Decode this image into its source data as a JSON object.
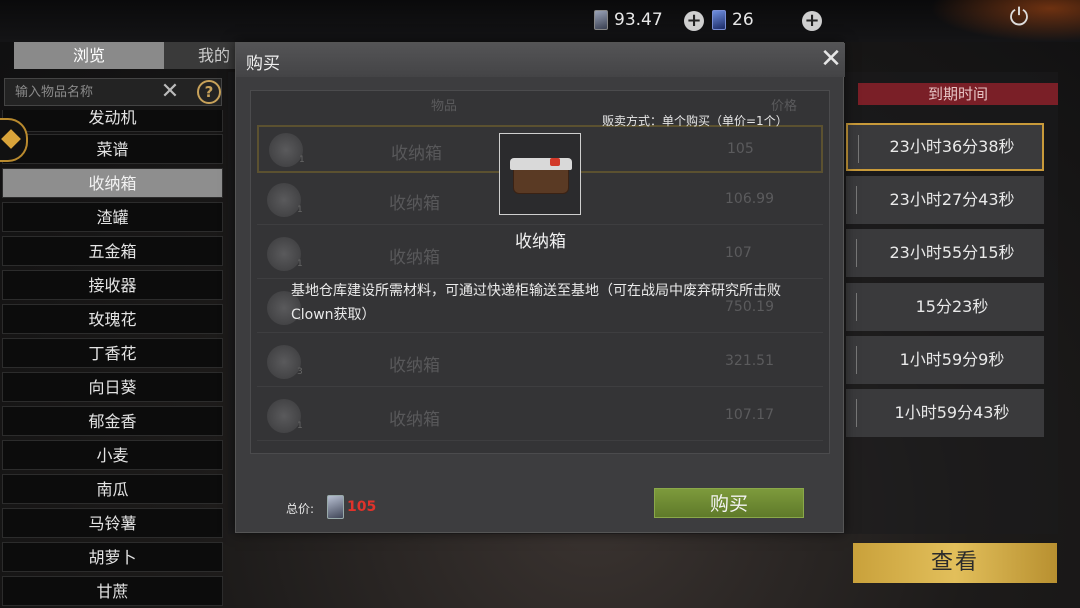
{
  "topbar": {
    "coin_value": "93.47",
    "gem_value": "26",
    "icons": [
      "coin-icon",
      "plus-icon",
      "gem-icon",
      "power-icon"
    ]
  },
  "tabs": {
    "browse": "浏览",
    "mine": "我的"
  },
  "search": {
    "placeholder": "输入物品名称"
  },
  "categories": [
    "发动机",
    "菜谱",
    "收纳箱",
    "渣罐",
    "五金箱",
    "接收器",
    "玫瑰花",
    "丁香花",
    "向日葵",
    "郁金香",
    "小麦",
    "南瓜",
    "马铃薯",
    "胡萝卜",
    "甘蔗"
  ],
  "selected_category": "收纳箱",
  "expiry": {
    "header": "到期时间",
    "rows": [
      "23小时36分38秒",
      "23小时27分43秒",
      "23小时55分15秒",
      "15分23秒",
      "1小时59分9秒",
      "1小时59分43秒"
    ]
  },
  "view_button": "查看",
  "modal": {
    "title": "购买",
    "sale_mode": "贩卖方式：单个购买（单价=1个）",
    "item_name": "收纳箱",
    "description": "基地仓库建设所需材料，可通过快递柜输送至基地（可在战局中废弃研究所击败Clown获取）",
    "listing_header": {
      "name": "物品",
      "price": "价格"
    },
    "listings": [
      {
        "name": "收纳箱",
        "qty": "1",
        "price": "105"
      },
      {
        "name": "收纳箱",
        "qty": "1",
        "price": "106.99"
      },
      {
        "name": "收纳箱",
        "qty": "1",
        "price": "107"
      },
      {
        "name": "收纳箱",
        "qty": "1",
        "price": "750.19"
      },
      {
        "name": "收纳箱",
        "qty": "3",
        "price": "321.51"
      },
      {
        "name": "收纳箱",
        "qty": "1",
        "price": "107.17"
      }
    ],
    "total_label": "总价:",
    "total_price": "105",
    "buy_label": "购买"
  }
}
